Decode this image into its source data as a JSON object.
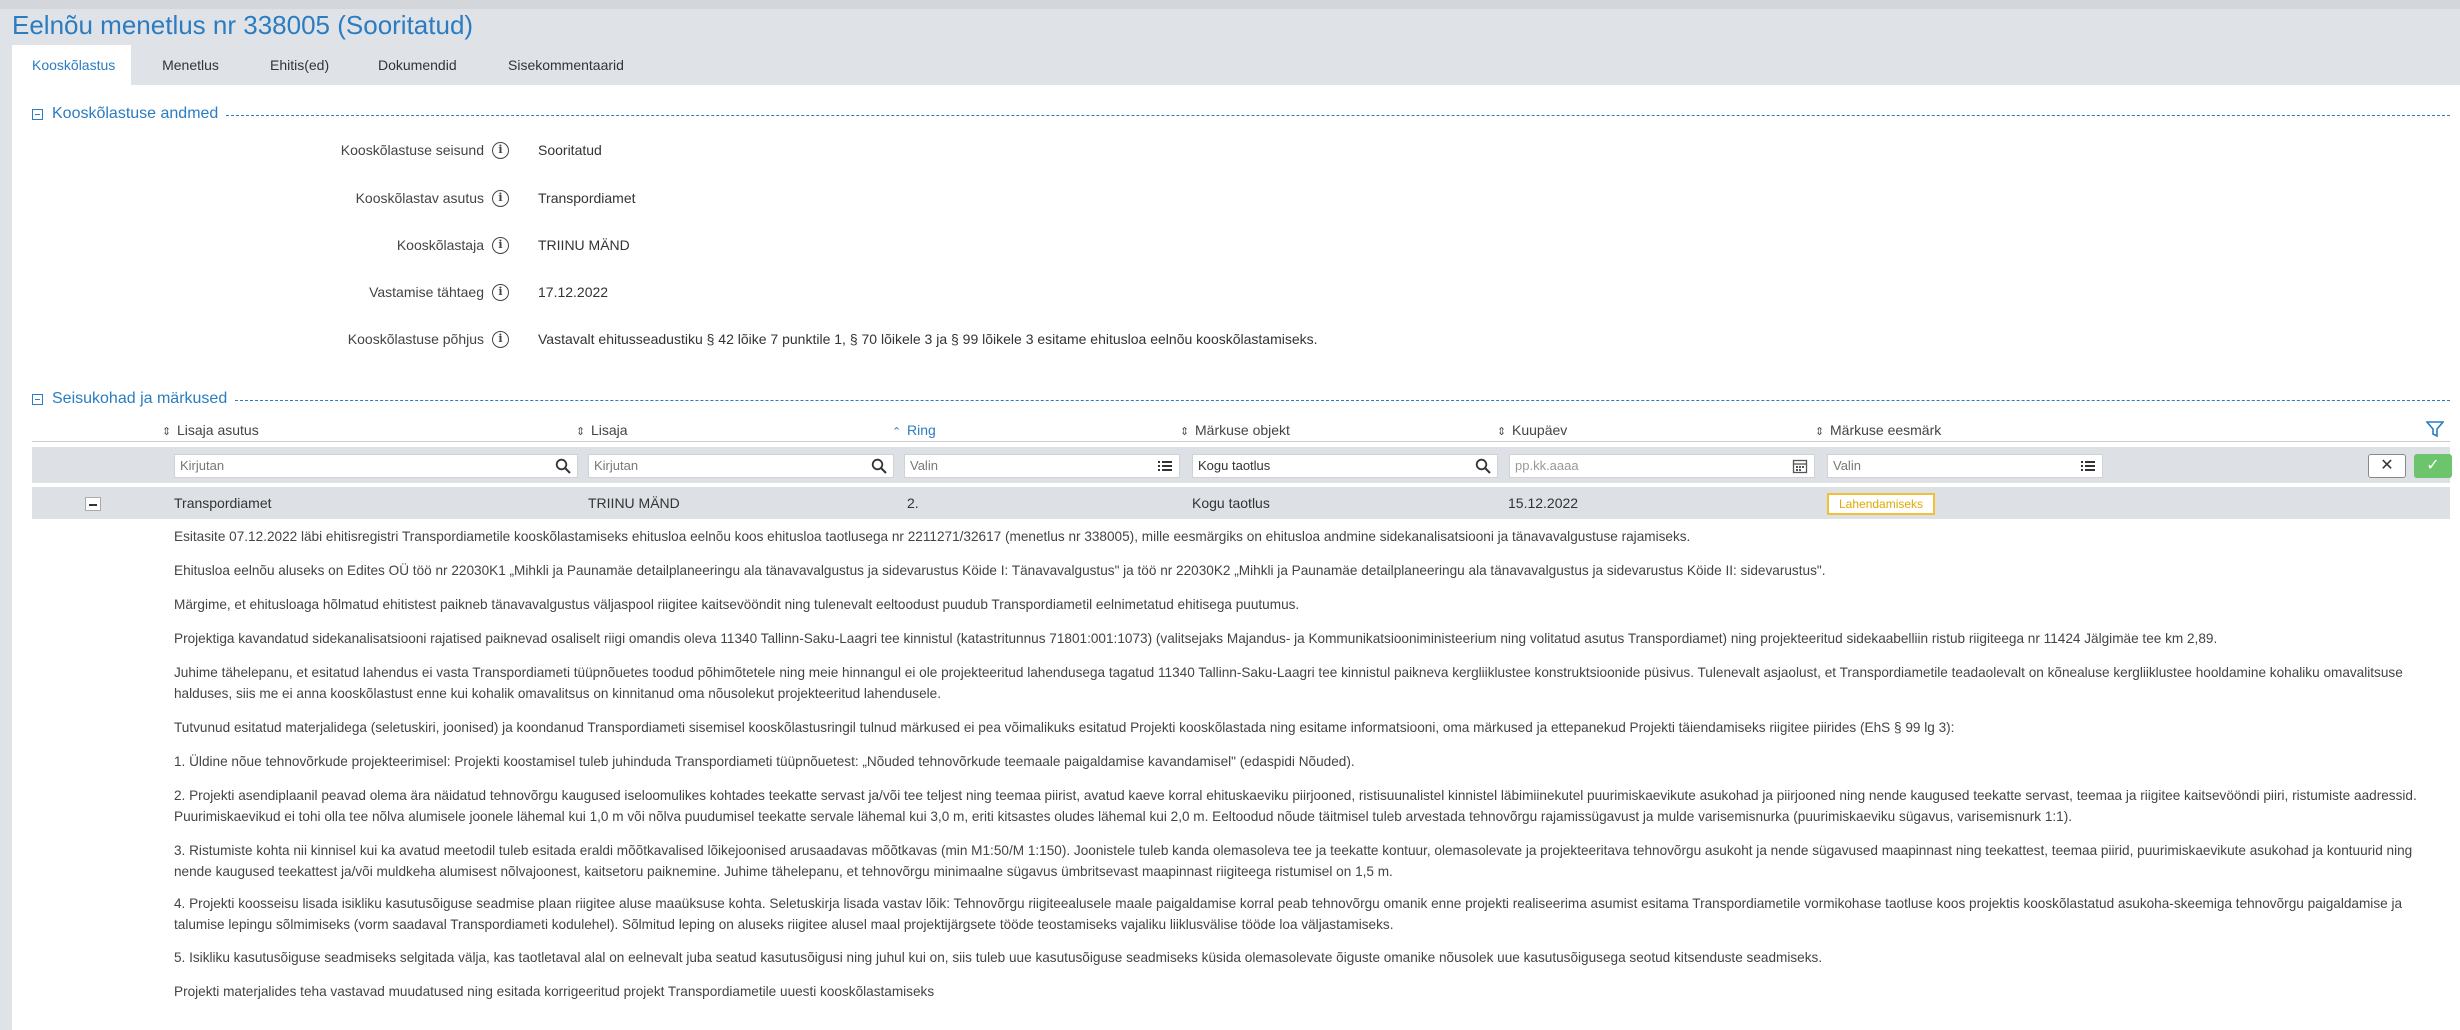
{
  "page": {
    "title": "Eelnõu menetlus nr 338005 (Sooritatud)"
  },
  "tabs": [
    {
      "label": "Kooskõlastus",
      "active": true
    },
    {
      "label": "Menetlus",
      "active": false
    },
    {
      "label": "Ehitis(ed)",
      "active": false
    },
    {
      "label": "Dokumendid",
      "active": false
    },
    {
      "label": "Sisekommentaarid",
      "active": false
    }
  ],
  "section_approval": {
    "title": "Kooskõlastuse andmed",
    "fields": [
      {
        "label": "Kooskõlastuse seisund",
        "value": "Sooritatud"
      },
      {
        "label": "Kooskõlastav asutus",
        "value": "Transpordiamet"
      },
      {
        "label": "Kooskõlastaja",
        "value": "TRIINU MÄND"
      },
      {
        "label": "Vastamise tähtaeg",
        "value": "17.12.2022"
      },
      {
        "label": "Kooskõlastuse põhjus",
        "value": "Vastavalt ehitusseadustiku § 42 lõike 7 punktile 1, § 70 lõikele 3 ja § 99 lõikele 3 esitame ehitusloa eelnõu kooskõlastamiseks."
      }
    ]
  },
  "section_positions": {
    "title": "Seisukohad ja märkused",
    "columns": [
      {
        "label": "Lisaja asutus",
        "sort": "none"
      },
      {
        "label": "Lisaja",
        "sort": "none"
      },
      {
        "label": "Ring",
        "sort": "asc"
      },
      {
        "label": "Märkuse objekt",
        "sort": "none"
      },
      {
        "label": "Kuupäev",
        "sort": "none"
      },
      {
        "label": "Märkuse eesmärk",
        "sort": "none"
      }
    ],
    "filters": [
      {
        "placeholder": "Kirjutan",
        "icon": "search-icon"
      },
      {
        "placeholder": "Kirjutan",
        "icon": "search-icon"
      },
      {
        "placeholder": "Valin",
        "icon": "list-icon"
      },
      {
        "value": "Kogu taotlus",
        "icon": "search-icon"
      },
      {
        "placeholder": "pp.kk.aaaa",
        "icon": "calendar-icon"
      },
      {
        "placeholder": "Valin",
        "icon": "list-icon"
      }
    ],
    "row": {
      "asutus": "Transpordiamet",
      "lisaja": "TRIINU MÄND",
      "ring": "2.",
      "objekt": "Kogu taotlus",
      "kuupaev": "15.12.2022",
      "eesmark": "Lahendamiseks"
    },
    "detail": [
      "Esitasite 07.12.2022 läbi ehitisregistri Transpordiametile kooskõlastamiseks ehitusloa eelnõu koos ehitusloa taotlusega nr 2211271/32617 (menetlus nr 338005), mille eesmärgiks on ehitusloa andmine sidekanalisatsiooni ja tänavavalgustuse rajamiseks.",
      "Ehitusloa eelnõu aluseks on Edites OÜ töö nr 22030K1 „Mihkli ja Paunamäe detailplaneeringu ala tänavavalgustus ja sidevarustus Köide I: Tänavavalgustus\" ja töö nr 22030K2 „Mihkli ja Paunamäe detailplaneeringu ala tänavavalgustus ja sidevarustus Köide II: sidevarustus\".",
      "Märgime, et ehitusloaga hõlmatud ehitistest paikneb tänavavalgustus väljaspool riigitee kaitsevööndit ning tulenevalt eeltoodust puudub Transpordiametil eelnimetatud ehitisega puutumus.",
      "Projektiga kavandatud sidekanalisatsiooni rajatised paiknevad osaliselt riigi omandis oleva 11340 Tallinn-Saku-Laagri tee kinnistul (katastritunnus 71801:001:1073) (valitsejaks Majandus- ja Kommunikatsiooniministeerium ning volitatud asutus Transpordiamet) ning projekteeritud sidekaabelliin ristub riigiteega nr 11424 Jälgimäe tee km 2,89.",
      "Juhime tähelepanu, et esitatud lahendus ei vasta Transpordiameti tüüpnõuetes toodud põhimõtetele ning meie hinnangul ei ole projekteeritud lahendusega tagatud 11340 Tallinn-Saku-Laagri tee kinnistul paikneva kergliiklustee konstruktsioonide püsivus. Tulenevalt asjaolust, et Transpordiametile teadaolevalt on kõnealuse kergliiklustee hooldamine kohaliku omavalitsuse halduses, siis me ei anna kooskõlastust enne kui kohalik omavalitsus on kinnitanud oma nõusolekut projekteeritud lahendusele.",
      "Tutvunud esitatud materjalidega (seletuskiri, joonised) ja koondanud Transpordiameti sisemisel kooskõlastusringil tulnud märkused ei pea võimalikuks esitatud Projekti kooskõlastada ning esitame informatsiooni, oma märkused ja ettepanekud Projekti täiendamiseks riigitee piirides (EhS § 99 lg 3):",
      "1. Üldine nõue tehnovõrkude projekteerimisel: Projekti koostamisel tuleb juhinduda Transpordiameti tüüpnõuetest: „Nõuded tehnovõrkude teemaale paigaldamise kavandamisel\" (edaspidi Nõuded).",
      "2. Projekti asendiplaanil peavad olema ära näidatud tehnovõrgu kaugused iseloomulikes kohtades teekatte servast ja/või tee teljest ning teemaa piirist, avatud kaeve korral ehituskaeviku piirjooned, ristisuunalistel kinnistel läbimiinekutel puurimiskaevikute asukohad ja piirjooned ning nende kaugused teekatte servast, teemaa ja riigitee kaitsevööndi piiri, ristumiste aadressid. Puurimiskaevikud ei tohi olla tee nõlva alumisele joonele lähemal kui 1,0 m või nõlva puudumisel teekatte servale lähemal kui 3,0 m, eriti kitsastes oludes lähemal kui 2,0 m. Eeltoodud nõude täitmisel tuleb arvestada tehnovõrgu rajamissügavust ja mulde varisemisnurka (puurimiskaeviku sügavus, varisemisnurk 1:1).",
      "3. Ristumiste kohta nii kinnisel kui ka avatud meetodil tuleb esitada eraldi mõõtkavalised lõikejoonised arusaadavas mõõtkavas (min M1:50/M 1:150). Joonistele tuleb kanda olemasoleva tee ja teekatte kontuur, olemasolevate ja projekteeritava tehnovõrgu asukoht ja nende sügavused maapinnast ning teekattest, teemaa piirid, puurimiskaevikute asukohad ja kontuurid ning nende kaugused teekattest ja/või muldkeha alumisest nõlvajoonest, kaitsetoru paiknemine. Juhime tähelepanu, et tehnovõrgu minimaalne sügavus ümbritsevast maapinnast riigiteega ristumisel on 1,5 m.",
      "4. Projekti koosseisu lisada isikliku kasutusõiguse seadmise plaan riigitee aluse maaüksuse kohta. Seletuskirja lisada vastav lõik: Tehnovõrgu riigiteealusele maale paigaldamise korral peab tehnovõrgu omanik enne projekti realiseerima asumist esitama Transpordiametile vormikohase taotluse koos projektis kooskõlastatud asukoha-skeemiga tehnovõrgu paigaldamise ja talumise lepingu sõlmimiseks (vorm saadaval Transpordiameti kodulehel). Sõlmitud leping on aluseks riigitee alusel maal projektijärgsete tööde teostamiseks vajaliku liiklusvälise tööde loa väljastamiseks.",
      "5. Isikliku kasutusõiguse seadmiseks selgitada välja, kas taotletaval alal on eelnevalt juba seatud kasutusõigusi ning juhul kui on, siis tuleb uue kasutusõiguse seadmiseks küsida olemasolevate õiguste omanike nõusolek uue kasutusõigusega seotud kitsenduste seadmiseks.",
      "Projekti materjalides teha vastavad muudatused ning esitada korrigeeritud projekt Transpordiametile uuesti kooskõlastamiseks"
    ]
  }
}
